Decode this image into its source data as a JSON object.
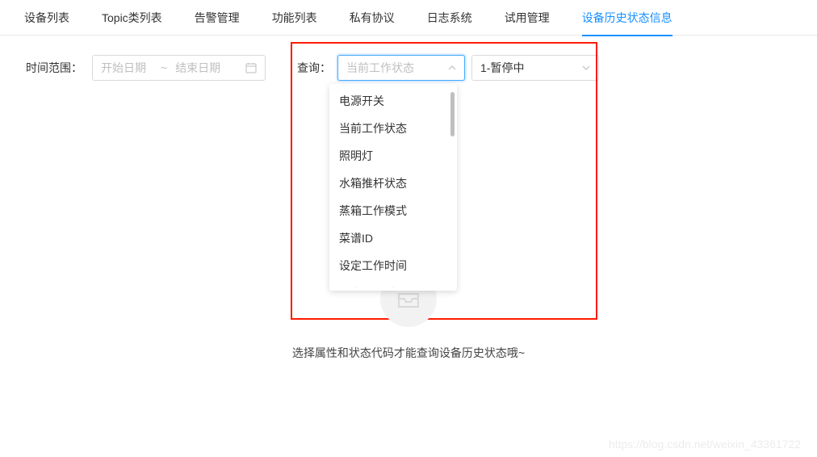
{
  "tabs": [
    {
      "label": "设备列表"
    },
    {
      "label": "Topic类列表"
    },
    {
      "label": "告警管理"
    },
    {
      "label": "功能列表"
    },
    {
      "label": "私有协议"
    },
    {
      "label": "日志系统"
    },
    {
      "label": "试用管理"
    },
    {
      "label": "设备历史状态信息"
    }
  ],
  "activeTab": 7,
  "dateRange": {
    "label": "时间范围：",
    "startPlaceholder": "开始日期",
    "sep": "~",
    "endPlaceholder": "结束日期"
  },
  "query": {
    "label": "查询：",
    "attrSelect": {
      "value": "当前工作状态"
    },
    "statusSelect": {
      "value": "1-暂停中"
    },
    "options": [
      "电源开关",
      "当前工作状态",
      "照明灯",
      "水箱推杆状态",
      "蒸箱工作模式",
      "菜谱ID",
      "设定工作时间",
      "设定预约时间"
    ]
  },
  "emptyText": "选择属性和状态代码才能查询设备历史状态哦~",
  "watermark": "https://blog.csdn.net/weixin_43361722"
}
